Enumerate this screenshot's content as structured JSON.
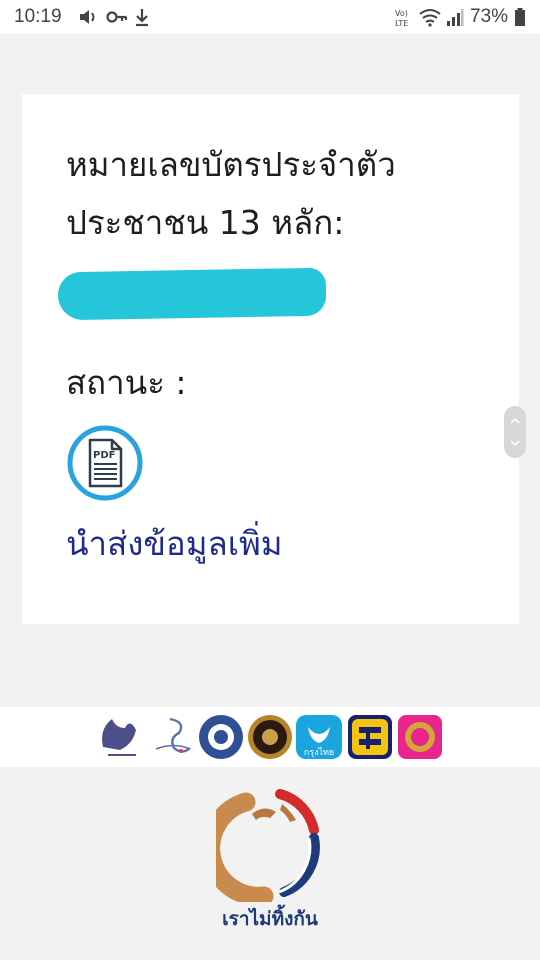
{
  "status_bar": {
    "time": "10:19",
    "battery": "73%",
    "icons": [
      "volume-icon",
      "key-icon",
      "download-icon",
      "volte-icon",
      "wifi-icon",
      "signal-icon",
      "battery-icon"
    ]
  },
  "card": {
    "id_label_line1": "หมายเลขบัตรประจำตัว",
    "id_label_line2": "ประชาชน 13 หลัก:",
    "status_label": "สถานะ :",
    "pdf_icon_text": "PDF",
    "submit_link": "นำส่งข้อมูลเพิ่ม"
  },
  "logos": [
    "revenue-department-logo",
    "sso-logo",
    "ministry-of-finance-logo",
    "government-seal-logo",
    "krungthai-bank-logo",
    "baac-bank-logo",
    "government-savings-bank-logo"
  ],
  "krungthai_label": "กรุงไทย",
  "footer": {
    "slogan": "เราไม่ทิ้งกัน"
  },
  "colors": {
    "accent_cyan": "#26c6da",
    "link_blue": "#1f2b8c",
    "pdf_ring": "#29a3e0"
  }
}
